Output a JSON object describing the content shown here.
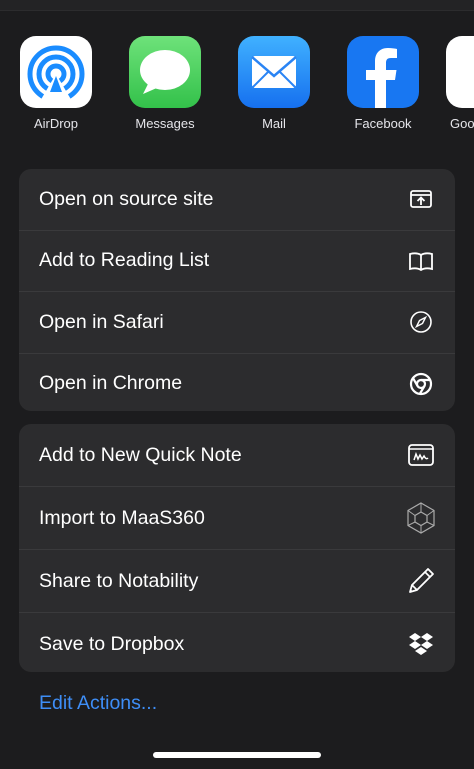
{
  "share_targets": [
    {
      "label": "AirDrop",
      "icon": "airdrop-icon"
    },
    {
      "label": "Messages",
      "icon": "messages-icon"
    },
    {
      "label": "Mail",
      "icon": "mail-icon"
    },
    {
      "label": "Facebook",
      "icon": "facebook-icon"
    },
    {
      "label": "Goo",
      "icon": "google-icon"
    }
  ],
  "actions_group_1": [
    {
      "label": "Open on source site",
      "icon": "open-source-icon"
    },
    {
      "label": "Add to Reading List",
      "icon": "reading-list-icon"
    },
    {
      "label": "Open in Safari",
      "icon": "safari-compass-icon"
    },
    {
      "label": "Open in Chrome",
      "icon": "chrome-icon"
    }
  ],
  "actions_group_2": [
    {
      "label": "Add to New Quick Note",
      "icon": "quick-note-icon"
    },
    {
      "label": "Import to MaaS360",
      "icon": "maas360-icon"
    },
    {
      "label": "Share to Notability",
      "icon": "pencil-icon"
    },
    {
      "label": "Save to Dropbox",
      "icon": "dropbox-icon"
    }
  ],
  "edit_actions_label": "Edit Actions...",
  "colors": {
    "background": "#1c1c1e",
    "group": "#2c2c2e",
    "link": "#3e8ef7"
  }
}
